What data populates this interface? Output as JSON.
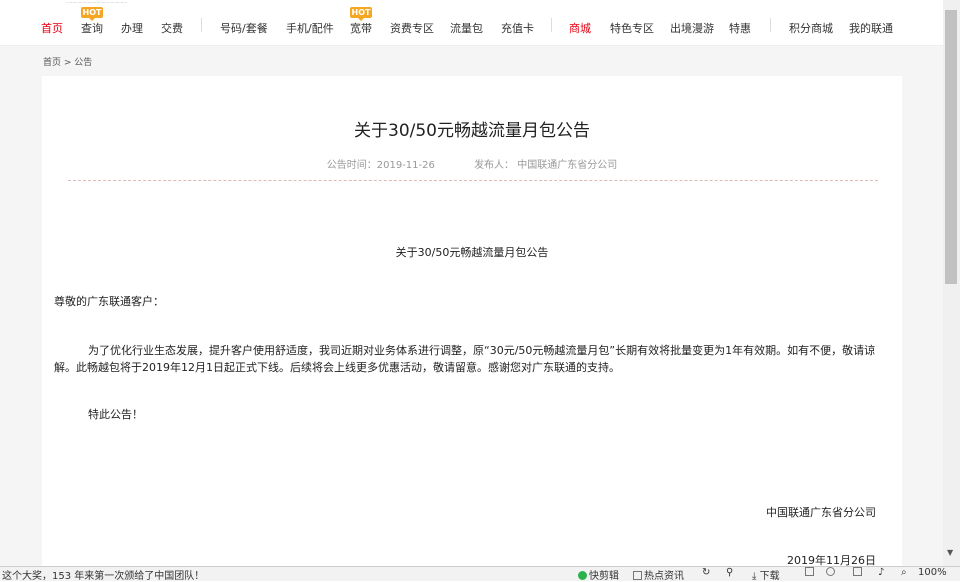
{
  "nav": {
    "items": [
      "首页",
      "查询",
      "办理",
      "交费",
      "号码/套餐",
      "手机/配件",
      "宽带",
      "资费专区",
      "流量包",
      "充值卡",
      "商城",
      "特色专区",
      "出境漫游",
      "特惠",
      "积分商城",
      "我的联通"
    ],
    "hot_badge": "HOT"
  },
  "breadcrumb": "首页 > 公告",
  "article": {
    "title": "关于30/50元畅越流量月包公告",
    "time_label": "公告时间：2019-11-26",
    "publisher_label": "发布人：  中国联通广东省分公司",
    "subtitle": "关于30/50元畅越流量月包公告",
    "greeting": "尊敬的广东联通客户：",
    "body": "为了优化行业生态发展，提升客户使用舒适度，我司近期对业务体系进行调整，原“30元/50元畅越流量月包”长期有效将批量变更为1年有效期。如有不便，敬请谅解。此畅越包将于2019年12月1日起正式下线。后续将会上线更多优惠活动，敬请留意。感谢您对广东联通的支持。",
    "closing": "特此公告！",
    "signoff": "中国联通广东省分公司",
    "date": "2019年11月26日"
  },
  "statusbar": {
    "news": "这个大奖，153 年来第一次颁给了中国团队！",
    "quick_clip": "快剪辑",
    "hot_news": "热点资讯",
    "download": "下载",
    "zoom": "100%"
  },
  "colors": {
    "accent": "#e60012",
    "hot": "#f5a623"
  }
}
